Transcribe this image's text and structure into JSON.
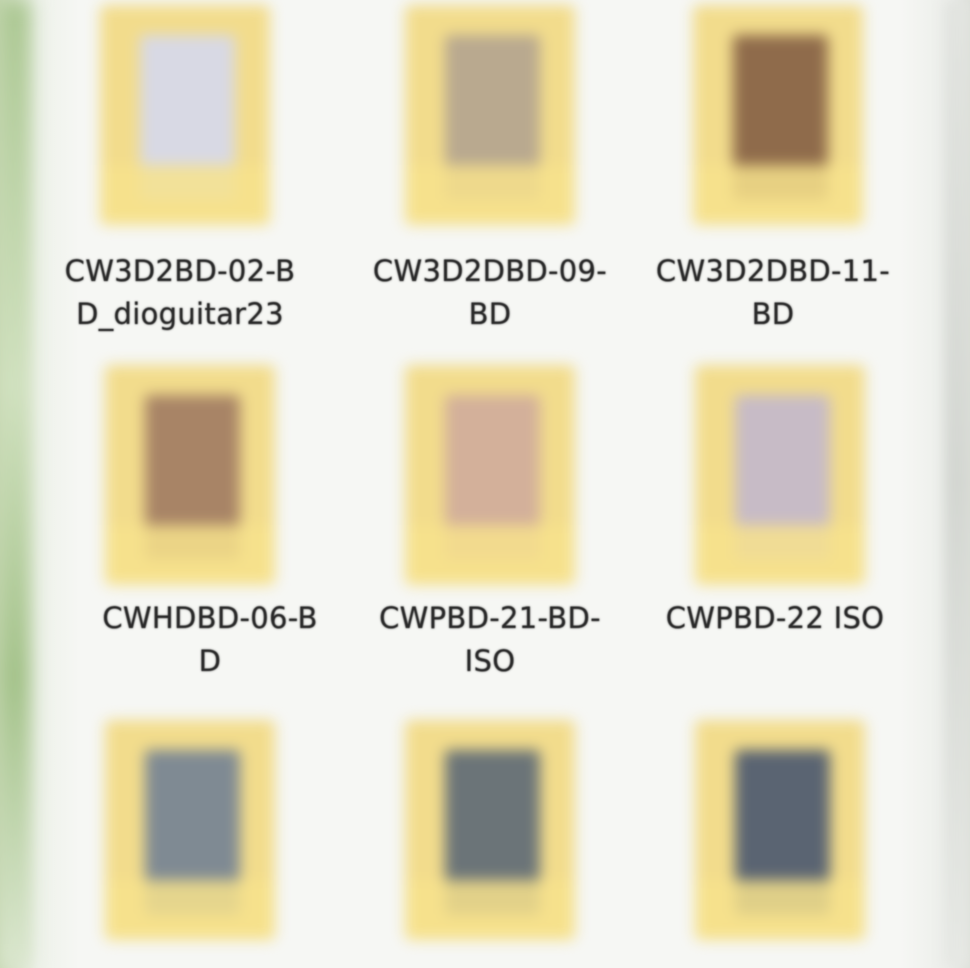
{
  "folders": [
    {
      "label_line1": "CW3D2BD-02-B",
      "label_line2": "D_dioguitar23",
      "photo_color": "#d8d9e4"
    },
    {
      "label_line1": "CW3D2DBD-09-",
      "label_line2": "BD",
      "photo_color": "#b9a98f"
    },
    {
      "label_line1": "CW3D2DBD-11-",
      "label_line2": "BD",
      "photo_color": "#8f6b4b"
    },
    {
      "label_line1": "CWHDBD-06-B",
      "label_line2": "D",
      "photo_color": "#a88466"
    },
    {
      "label_line1": "CWPBD-21-BD-",
      "label_line2": "ISO",
      "photo_color": "#d3b09a"
    },
    {
      "label_line1": "CWPBD-22 ISO",
      "label_line2": "",
      "photo_color": "#c7bbc6"
    },
    {
      "label_line1": "",
      "label_line2": "",
      "photo_color": "#7f8a93"
    },
    {
      "label_line1": "",
      "label_line2": "",
      "photo_color": "#6b7478"
    },
    {
      "label_line1": "",
      "label_line2": "",
      "photo_color": "#5a6472"
    }
  ]
}
